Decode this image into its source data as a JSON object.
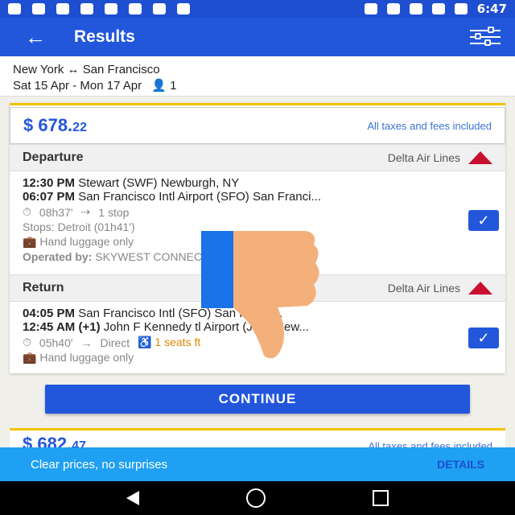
{
  "status": {
    "time": "6:47"
  },
  "header": {
    "title": "Results"
  },
  "trip": {
    "route": "New York ↔ San Francisco",
    "dates": "Sat 15 Apr - Mon 17 Apr",
    "passengers": "1"
  },
  "result": {
    "price_main": "$ 678.",
    "price_cents": "22",
    "taxes_note": "All taxes and fees included",
    "departure": {
      "label": "Departure",
      "airline": "Delta Air Lines",
      "line1_time": "12:30 PM",
      "line1_place": "Stewart (SWF) Newburgh, NY",
      "line2_time": "06:07 PM",
      "line2_place": "San Francisco Intl Airport (SFO) San Franci...",
      "duration": "08h37'",
      "stops": "1 stop",
      "stops_detail": "Stops: Detroit (01h41')",
      "luggage": "Hand luggage only",
      "operated_label": "Operated by:",
      "operated_value": "SKYWEST            CONNECTION"
    },
    "return": {
      "label": "Return",
      "airline": "Delta Air Lines",
      "line1_time": "04:05 PM",
      "line1_place": "San Francisco Intl        (SFO) San Franci...",
      "line2_time": "12:45 AM (+1)",
      "line2_place": "John F Kennedy   tl Airport (JFK) New...",
      "duration": "05h40'",
      "stops": "Direct",
      "seats": "1 seats    ft",
      "luggage": "Hand luggage only"
    }
  },
  "continue_label": "CONTINUE",
  "next_result": {
    "price_main": "$ 682.",
    "price_cents": "47",
    "taxes_note": "All taxes and fees included"
  },
  "banner": {
    "text": "Clear prices, no surprises",
    "details": "DETAILS"
  },
  "colors": {
    "brand": "#2257dc",
    "accent": "#f1c400",
    "banner": "#1fa0f2"
  }
}
